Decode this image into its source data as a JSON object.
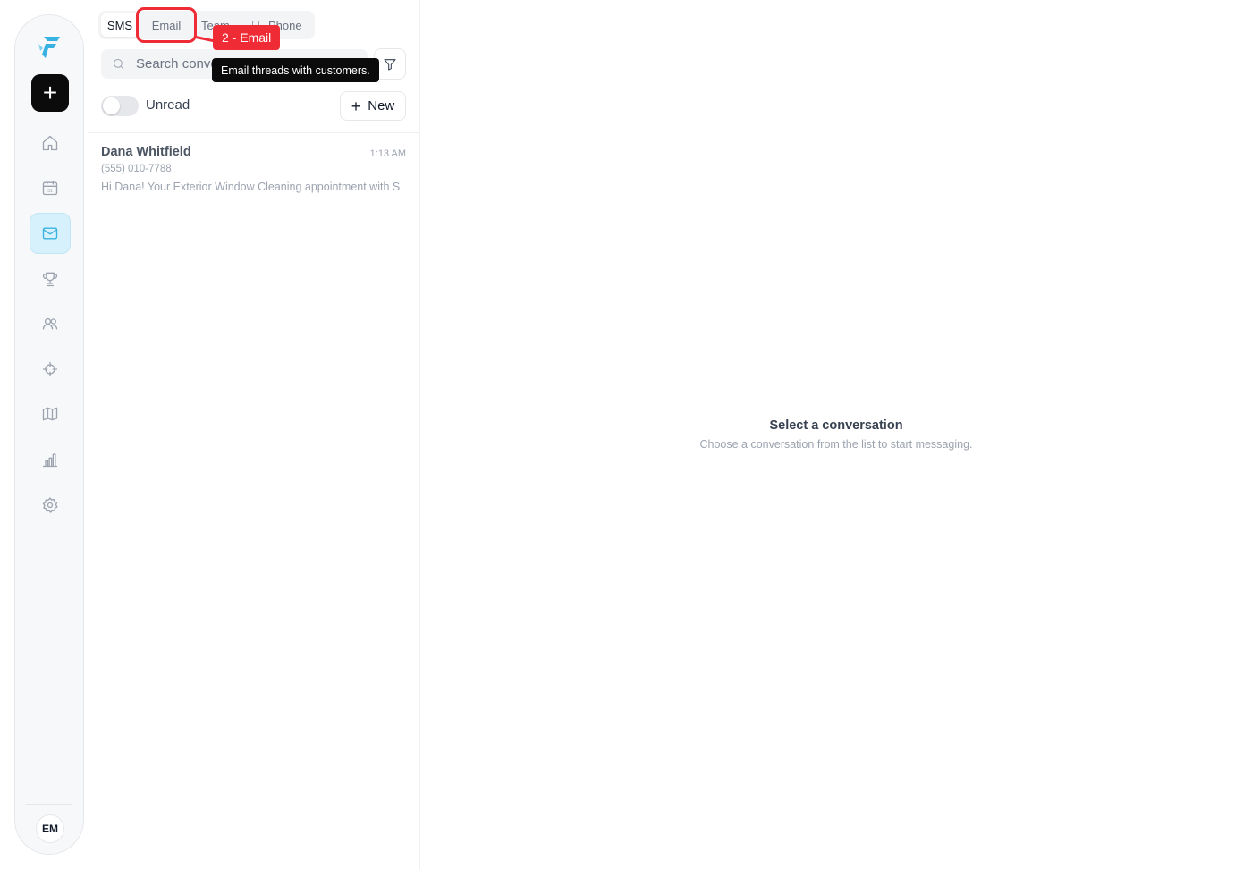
{
  "sidebar": {
    "logo_icon": "brand-logo",
    "compose_icon": "plus-icon",
    "items": [
      {
        "key": "home",
        "icon": "home-icon"
      },
      {
        "key": "calendar",
        "icon": "calendar-icon",
        "calendar_day": "31"
      },
      {
        "key": "messages",
        "icon": "mail-icon",
        "active": true
      },
      {
        "key": "rewards",
        "icon": "trophy-icon"
      },
      {
        "key": "customers",
        "icon": "users-icon"
      },
      {
        "key": "targets",
        "icon": "crosshair-icon"
      },
      {
        "key": "map",
        "icon": "map-icon"
      },
      {
        "key": "reports",
        "icon": "bar-chart-icon"
      },
      {
        "key": "settings",
        "icon": "gear-icon"
      }
    ],
    "avatar_initials": "EM"
  },
  "tabs": {
    "sms": "SMS",
    "email": "Email",
    "team": "Team",
    "phone": "Phone",
    "selected": "SMS"
  },
  "annotation": {
    "label": "2 - Email",
    "tooltip": "Email threads with customers.",
    "color": "#ef2b36"
  },
  "search": {
    "placeholder": "Search conversations"
  },
  "filters": {
    "unread_label": "Unread",
    "unread_on": false,
    "new_label": "New"
  },
  "conversations": [
    {
      "name": "Dana Whitfield",
      "time": "1:13 AM",
      "phone": "(555) 010-7788",
      "preview": "Hi Dana! Your Exterior Window Cleaning appointment with S"
    }
  ],
  "empty_state": {
    "title": "Select a conversation",
    "subtitle": "Choose a conversation from the list to start messaging."
  },
  "colors": {
    "accent": "#38b2e0",
    "active_bg": "#d6f1fb",
    "compose_bg": "#0b0b0c"
  }
}
